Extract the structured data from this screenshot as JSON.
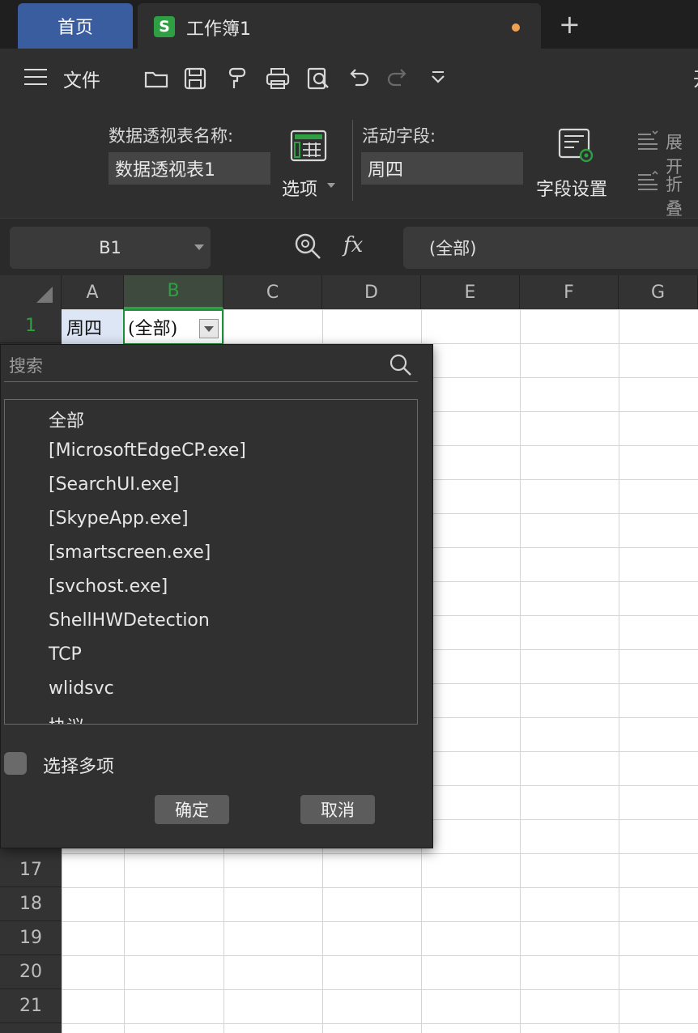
{
  "tabs": {
    "home": "首页",
    "document": "工作簿1",
    "add": "+"
  },
  "toolbar": {
    "file": "文件",
    "cut_glyph": "开"
  },
  "ribbon": {
    "pivot_name_label": "数据透视表名称:",
    "pivot_name_value": "数据透视表1",
    "options_label": "选项",
    "active_field_label": "活动字段:",
    "active_field_value": "周四",
    "field_settings_label": "字段设置",
    "expand_label": "展开",
    "collapse_label": "折叠"
  },
  "formula_bar": {
    "name_box": "B1",
    "fx": "fx",
    "formula": "(全部)"
  },
  "sheet": {
    "columns": [
      "A",
      "B",
      "C",
      "D",
      "E",
      "F",
      "G"
    ],
    "rows": [
      "1",
      "17",
      "18",
      "19",
      "20",
      "21"
    ],
    "cell_A1": "周四",
    "cell_B1": "(全部)"
  },
  "filter": {
    "search_placeholder": "搜索",
    "items": [
      "全部",
      "[MicrosoftEdgeCP.exe]",
      "[SearchUI.exe]",
      "[SkypeApp.exe]",
      "[smartscreen.exe]",
      "[svchost.exe]",
      "ShellHWDetection",
      "TCP",
      "wlidsvc",
      "协议"
    ],
    "multi_select_label": "选择多项",
    "ok_label": "确定",
    "cancel_label": "取消"
  },
  "colors": {
    "accent": "#2ea043",
    "home_tab": "#3a5da0",
    "modified_dot": "#f0a050"
  }
}
